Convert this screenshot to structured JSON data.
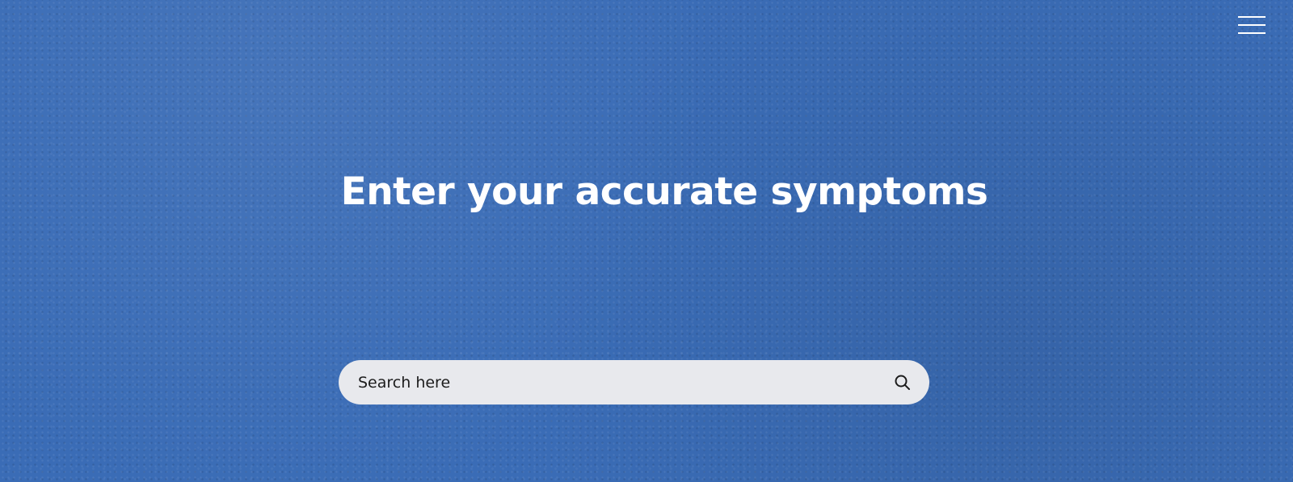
{
  "header": {
    "menu_icon": "hamburger-menu-icon"
  },
  "hero": {
    "title": "Enter your accurate symptoms",
    "background_color": "#3a6cb6",
    "text_color": "#ffffff"
  },
  "search": {
    "placeholder": "Search here",
    "value": "",
    "icon": "search-icon",
    "field_color": "#e8e9ed"
  }
}
